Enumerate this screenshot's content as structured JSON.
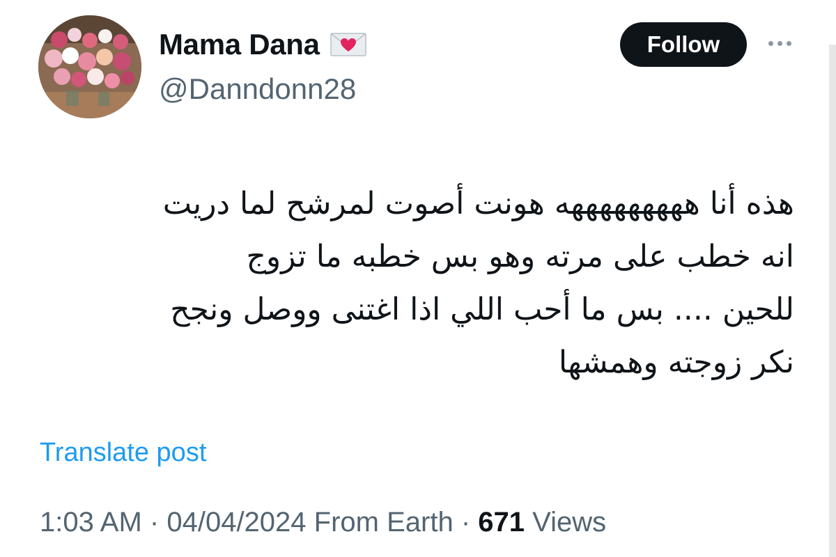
{
  "author": {
    "display_name": "Mama Dana",
    "handle": "@Danndonn28",
    "name_emoji": "love-letter-icon"
  },
  "actions": {
    "follow_label": "Follow"
  },
  "post": {
    "lines": [
      "هذه أنا هههههههههه هونت أصوت لمرشح لما دريت",
      "انه خطب على مرته وهو بس خطبه ما تزوج",
      "للحين .... بس ما أحب اللي اذا اغتنى ووصل ونجح",
      "نكر زوجته وهمشها"
    ],
    "translate_label": "Translate post"
  },
  "meta": {
    "time": "1:03 AM",
    "separator": "·",
    "date": "04/04/2024",
    "source": "From Earth",
    "views_count": "671",
    "views_label": "Views"
  },
  "colors": {
    "text": "#0f1419",
    "muted": "#536471",
    "link": "#1d9bf0",
    "follow_bg": "#0f1419",
    "heart": "#e0245e"
  }
}
